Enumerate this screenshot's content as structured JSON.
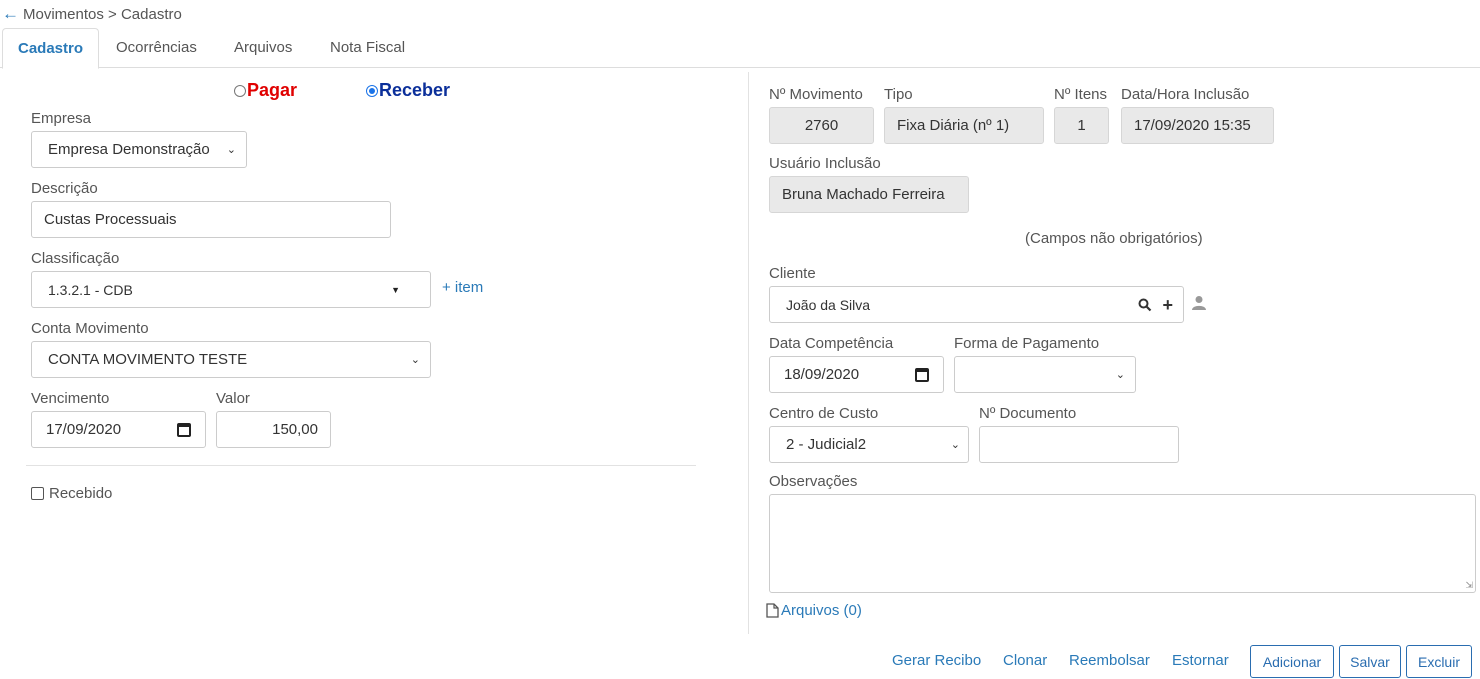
{
  "breadcrumb": {
    "text": "Movimentos > Cadastro"
  },
  "tabs": [
    {
      "label": "Cadastro"
    },
    {
      "label": "Ocorrências"
    },
    {
      "label": "Arquivos"
    },
    {
      "label": "Nota Fiscal"
    }
  ],
  "type_radio": {
    "pagar": {
      "label": "Pagar",
      "color": "#e00000",
      "checked": false
    },
    "receber": {
      "label": "Receber",
      "color": "#0b2f9a",
      "checked": true
    }
  },
  "form": {
    "empresa": {
      "label": "Empresa",
      "value": "Empresa Demonstração"
    },
    "descricao": {
      "label": "Descrição",
      "value": "Custas Processuais"
    },
    "classificacao": {
      "label": "Classificação",
      "value": "1.3.2.1 - CDB",
      "add_item": "+ item"
    },
    "conta_movimento": {
      "label": "Conta Movimento",
      "value": "CONTA MOVIMENTO TESTE"
    },
    "vencimento": {
      "label": "Vencimento",
      "value": "17/09/2020"
    },
    "valor": {
      "label": "Valor",
      "value": "150,00"
    },
    "recebido": {
      "label": "Recebido",
      "checked": false
    }
  },
  "info": {
    "n_movimento": {
      "label": "Nº Movimento",
      "value": "2760"
    },
    "tipo": {
      "label": "Tipo",
      "value": "Fixa Diária (nº 1)"
    },
    "n_itens": {
      "label": "Nº Itens",
      "value": "1"
    },
    "data_hora_inclusao": {
      "label": "Data/Hora Inclusão",
      "value": "17/09/2020 15:35"
    },
    "usuario_inclusao": {
      "label": "Usuário Inclusão",
      "value": "Bruna Machado Ferreira"
    },
    "optional_note": "(Campos não obrigatórios)"
  },
  "optional": {
    "cliente": {
      "label": "Cliente",
      "value": "João da Silva"
    },
    "data_competencia": {
      "label": "Data Competência",
      "value": "18/09/2020"
    },
    "forma_pagamento": {
      "label": "Forma de Pagamento",
      "value": ""
    },
    "centro_custo": {
      "label": "Centro de Custo",
      "value": "2 - Judicial2"
    },
    "n_documento": {
      "label": "Nº Documento",
      "value": ""
    },
    "observacoes": {
      "label": "Observações",
      "value": ""
    },
    "arquivos_link": "Arquivos (0)"
  },
  "actions": {
    "gerar_recibo": "Gerar Recibo",
    "clonar": "Clonar",
    "reembolsar": "Reembolsar",
    "estornar": "Estornar",
    "adicionar": "Adicionar",
    "salvar": "Salvar",
    "excluir": "Excluir"
  },
  "colors": {
    "accent": "#2a7ab8",
    "readonly_bg": "#e9e9e9"
  },
  "icons": [
    "back-arrow-icon",
    "calendar-icon",
    "search-icon",
    "plus-icon",
    "user-icon",
    "file-icon",
    "chevron-down-icon"
  ]
}
